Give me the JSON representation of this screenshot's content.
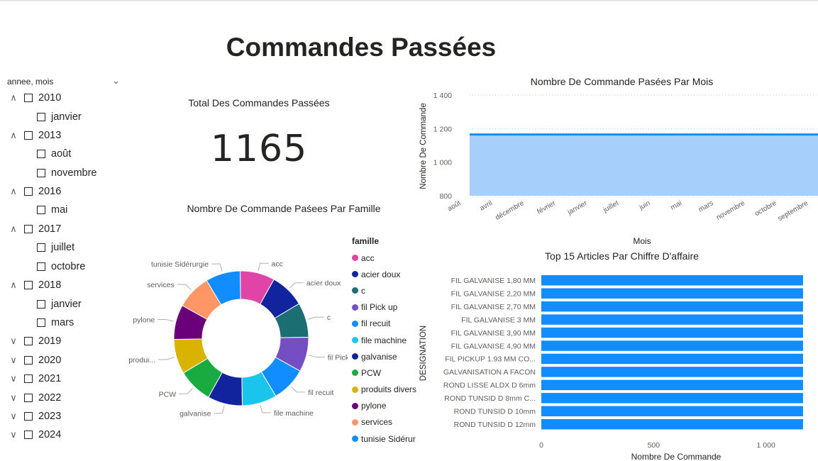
{
  "page": {
    "title": "Commandes Passées"
  },
  "slicer": {
    "header": "annee, mois",
    "items": [
      {
        "label": "2010",
        "level": 0,
        "expanded": true
      },
      {
        "label": "janvier",
        "level": 1
      },
      {
        "label": "2013",
        "level": 0,
        "expanded": true
      },
      {
        "label": "août",
        "level": 1
      },
      {
        "label": "novembre",
        "level": 1
      },
      {
        "label": "2016",
        "level": 0,
        "expanded": true
      },
      {
        "label": "mai",
        "level": 1
      },
      {
        "label": "2017",
        "level": 0,
        "expanded": true
      },
      {
        "label": "juillet",
        "level": 1
      },
      {
        "label": "octobre",
        "level": 1
      },
      {
        "label": "2018",
        "level": 0,
        "expanded": true
      },
      {
        "label": "janvier",
        "level": 1
      },
      {
        "label": "mars",
        "level": 1
      },
      {
        "label": "2019",
        "level": 0,
        "expanded": false
      },
      {
        "label": "2020",
        "level": 0,
        "expanded": false
      },
      {
        "label": "2021",
        "level": 0,
        "expanded": false
      },
      {
        "label": "2022",
        "level": 0,
        "expanded": false
      },
      {
        "label": "2023",
        "level": 0,
        "expanded": false
      },
      {
        "label": "2024",
        "level": 0,
        "expanded": false
      }
    ]
  },
  "kpi": {
    "title": "Total Des Commandes Passées",
    "value": "1165"
  },
  "donut": {
    "title": "Nombre De Commande Paśees Par Famille",
    "legend_title": "famille",
    "legend": [
      "acc",
      "acier doux",
      "c",
      "fil Pick up",
      "fil recuit",
      "file machine",
      "galvanise",
      "PCW",
      "produits divers",
      "pylone",
      "services",
      "tunisie Sidérur"
    ],
    "slice_labels": [
      "acc",
      "acier doux",
      "c",
      "fil Pick ...",
      "fil recuit",
      "file machine",
      "galvanise",
      "PCW",
      "produi...",
      "pylone",
      "services",
      "tunisie Sidérurgie"
    ]
  },
  "chart_data": [
    {
      "type": "area",
      "title": "Nombre De Commande Pasées Par Mois",
      "xlabel": "Mois",
      "ylabel": "Nombre De Commande",
      "ylim": [
        800,
        1400
      ],
      "yticks": [
        "800",
        "1 000",
        "1 200",
        "1 400"
      ],
      "yticks_values": [
        800,
        1000,
        1200,
        1400
      ],
      "categories": [
        "août",
        "avril",
        "décembre",
        "février",
        "janvier",
        "juillet",
        "juin",
        "mai",
        "mars",
        "novembre",
        "octobre",
        "septembre"
      ],
      "values": [
        1165,
        1165,
        1165,
        1165,
        1165,
        1165,
        1165,
        1165,
        1165,
        1165,
        1165,
        1165
      ],
      "grid": true,
      "color": "#118dff",
      "fill": "#a6d0fb"
    },
    {
      "type": "bar",
      "title": "Top 15 Articles Par Chiffre D'affaire",
      "xlabel": "Nombre De Commande",
      "ylabel": "DESIGNATION",
      "orientation": "horizontal",
      "xlim": [
        0,
        1200
      ],
      "xticks": [
        "0",
        "500",
        "1 000"
      ],
      "xticks_values": [
        0,
        500,
        1000
      ],
      "categories": [
        "FIL GALVANISE 1,80 MM",
        "FIL GALVANISE 2,20 MM",
        "FIL GALVANISE 2,70 MM",
        "FIL GALVANISE 3 MM",
        "FIL GALVANISE 3,90 MM",
        "FIL GALVANISE 4,90 MM",
        "FIL PICKUP 1.93 MM CO...",
        "GALVANISATION A FACON",
        "ROND LISSE ALDX D 6mm",
        "ROND TUNSID D 8mm C...",
        "ROND TUNSID D 10mm",
        "ROND TUNSID D 12mm"
      ],
      "values": [
        1165,
        1165,
        1165,
        1165,
        1165,
        1165,
        1165,
        1165,
        1165,
        1165,
        1165,
        1165
      ],
      "color": "#118dff"
    },
    {
      "type": "pie",
      "title": "Nombre De Commande Paśees Par Famille",
      "categories": [
        "acc",
        "acier doux",
        "c",
        "fil Pick up",
        "fil recuit",
        "file machine",
        "galvanise",
        "PCW",
        "produits divers",
        "pylone",
        "services",
        "tunisie Sidérurgie"
      ],
      "values": [
        1,
        1,
        1,
        1,
        1,
        1,
        1,
        1,
        1,
        1,
        1,
        1
      ],
      "colors": [
        "#e044a7",
        "#12239e",
        "#1b6e72",
        "#744ec2",
        "#118dff",
        "#1ac4eb",
        "#12239e",
        "#1aab40",
        "#d9b300",
        "#6b007b",
        "#fe9666",
        "#118dff"
      ]
    }
  ]
}
